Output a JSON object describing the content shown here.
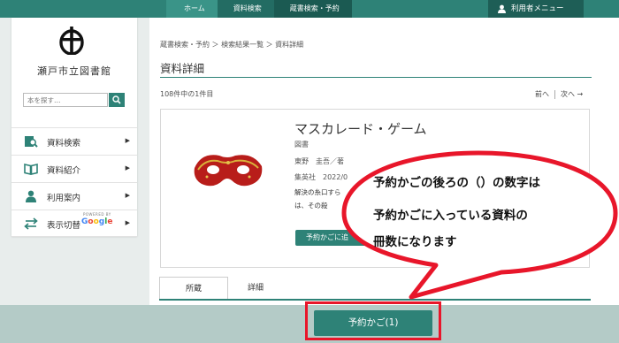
{
  "topbar": {
    "crumbs": [
      "ホーム",
      "資料検索",
      "蔵書検索・予約"
    ],
    "user_menu_label": "利用者メニュー"
  },
  "sidebar": {
    "library_name": "瀬戸市立図書館",
    "search_placeholder": "本を探す…",
    "items": [
      {
        "label": "資料検索",
        "icon": "search-book-icon"
      },
      {
        "label": "資料紹介",
        "icon": "open-book-icon"
      },
      {
        "label": "利用案内",
        "icon": "person-icon"
      },
      {
        "label": "表示切替",
        "icon": "switch-arrows-icon"
      }
    ]
  },
  "main": {
    "breadcrumb": "蔵書検索・予約 ＞ 検索結果一覧 ＞ 資料詳細",
    "page_title": "資料詳細",
    "result_count": "108件中の1件目",
    "prev_label": "前へ",
    "next_label": "次へ →",
    "book": {
      "title": "マスカレード・ゲーム",
      "type": "図書",
      "author": "東野　圭吾／著",
      "publisher": "集英社　2022/0",
      "desc_line1": "解決の糸口すら",
      "desc_line2": "は、その殺",
      "cart_button": "予約かごに追",
      "powered_by": "POWERED BY",
      "google": "Google"
    },
    "tabs": [
      "所蔵",
      "詳細"
    ]
  },
  "bottom": {
    "cart_button": "予約かご(1)"
  },
  "callout": {
    "lines": [
      "予約かごの後ろの（）の数字は",
      "予約かごに入っている資料の",
      "冊数になります"
    ]
  },
  "colors": {
    "accent": "#2e8277",
    "highlight": "#e8162a"
  }
}
